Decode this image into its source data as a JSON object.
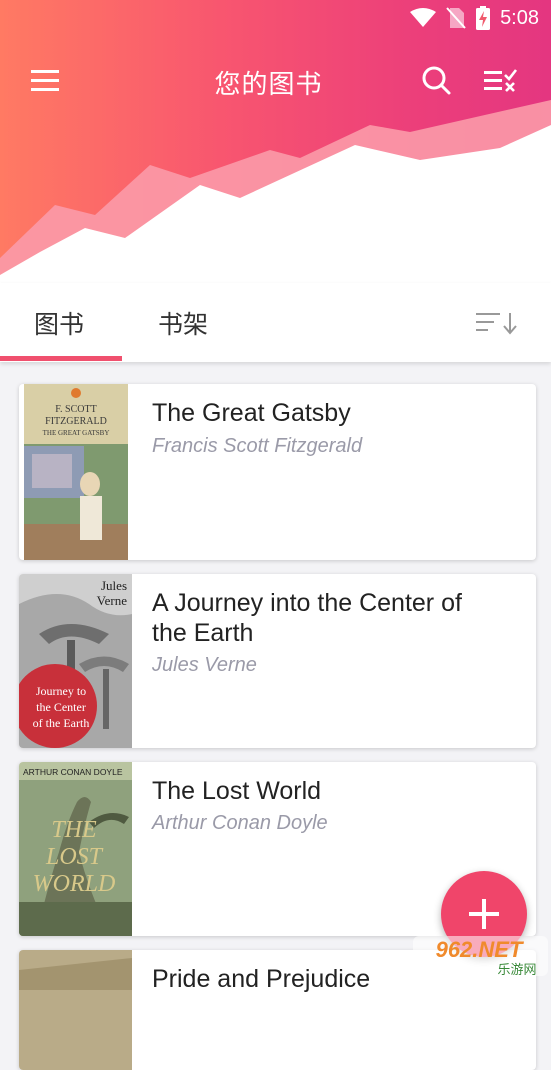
{
  "status_bar": {
    "time": "5:08",
    "icons": [
      "wifi-icon",
      "no-sim-icon",
      "battery-charging-icon"
    ]
  },
  "toolbar": {
    "title": "您的图书",
    "icons": [
      "menu-icon",
      "search-icon",
      "select-list-icon"
    ]
  },
  "tabs": [
    {
      "label": "图书",
      "active": true
    },
    {
      "label": "书架",
      "active": false
    }
  ],
  "sort_icon": "sort-descending-icon",
  "books": [
    {
      "title": "The Great Gatsby",
      "author": "Francis Scott Fitzgerald",
      "cover_lines": [
        "F. SCOTT",
        "FITZGERALD",
        "THE GREAT GATSBY"
      ]
    },
    {
      "title": "A Journey into the Center of the Earth",
      "author": "Jules Verne",
      "cover_lines": [
        "Jules",
        "Verne",
        "Journey to",
        "the Center",
        "of the Earth"
      ]
    },
    {
      "title": "The Lost World",
      "author": "Arthur Conan Doyle",
      "cover_lines": [
        "ARTHUR CONAN DOYLE",
        "THE",
        "LOST",
        "WORLD"
      ]
    },
    {
      "title": "Pride and Prejudice",
      "author": ""
    }
  ],
  "fab": {
    "icon": "plus-icon"
  },
  "watermark": {
    "text": "962.NET",
    "subtext": "乐游网"
  },
  "colors": {
    "accent": "#f0506e",
    "header_start": "#ff7a63",
    "header_end": "#e43680"
  }
}
